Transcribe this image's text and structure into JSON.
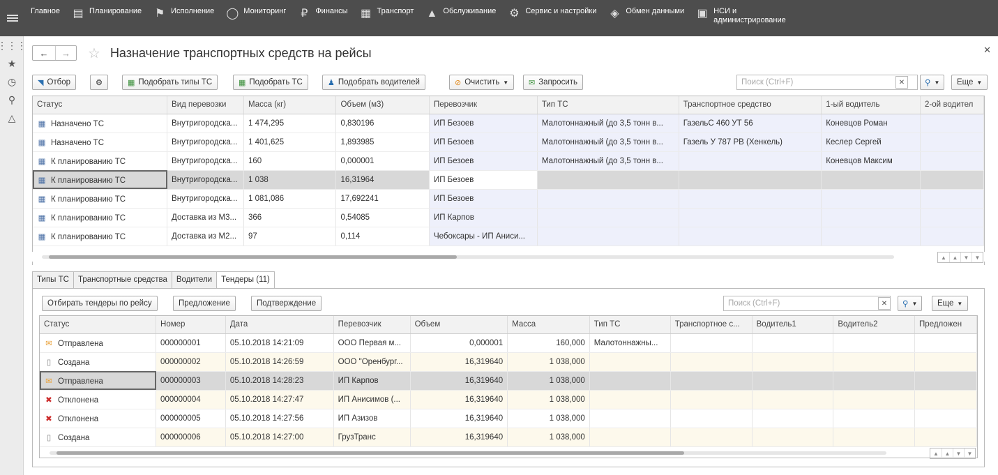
{
  "topmenu": [
    {
      "label": "Главное",
      "icon": "menu-icon"
    },
    {
      "label": "Планирование",
      "icon": "calendar-icon"
    },
    {
      "label": "Исполнение",
      "icon": "flag-icon"
    },
    {
      "label": "Мониторинг",
      "icon": "globe-icon"
    },
    {
      "label": "Финансы",
      "icon": "ruble-icon"
    },
    {
      "label": "Транспорт",
      "icon": "truck-icon"
    },
    {
      "label": "Обслуживание",
      "icon": "drop-icon"
    },
    {
      "label": "Сервис и настройки",
      "icon": "gear-icon"
    },
    {
      "label": "Обмен данными",
      "icon": "exchange-icon"
    },
    {
      "label": "НСИ и администрирование",
      "icon": "monitor-icon"
    }
  ],
  "page_title": "Назначение транспортных средств на рейсы",
  "toolbar": {
    "filter": "Отбор",
    "pick_types": "Подобрать типы ТС",
    "pick_vehicles": "Подобрать ТС",
    "pick_drivers": "Подобрать водителей",
    "clear": "Очистить",
    "request": "Запросить",
    "search_placeholder": "Поиск (Ctrl+F)",
    "more": "Еще"
  },
  "top_table": {
    "columns": [
      "Статус",
      "Вид перевозки",
      "Масса (кг)",
      "Объем (м3)",
      "Перевозчик",
      "Тип ТС",
      "Транспортное средство",
      "1-ый водитель",
      "2-ой водител"
    ],
    "rows": [
      [
        "Назначено ТС",
        "Внутригородска...",
        "1 474,295",
        "0,830196",
        "ИП Безоев",
        "Малотоннажный (до 3,5 тонн в...",
        "ГазельС 460 УТ 56",
        "Коневцов Роман",
        ""
      ],
      [
        "Назначено ТС",
        "Внутригородска...",
        "1 401,625",
        "1,893985",
        "ИП Безоев",
        "Малотоннажный (до 3,5 тонн в...",
        "Газель У 787 РВ (Хенкель)",
        "Кеслер Сергей",
        ""
      ],
      [
        "К планированию ТС",
        "Внутригородска...",
        "160",
        "0,000001",
        "ИП Безоев",
        "Малотоннажный (до 3,5 тонн в...",
        "",
        "Коневцов Максим",
        ""
      ],
      [
        "К планированию ТС",
        "Внутригородска...",
        "1 038",
        "16,31964",
        "ИП Безоев",
        "",
        "",
        "",
        ""
      ],
      [
        "К планированию ТС",
        "Внутригородска...",
        "1 081,086",
        "17,692241",
        "ИП Безоев",
        "",
        "",
        "",
        ""
      ],
      [
        "К планированию ТС",
        "Доставка из М3...",
        "366",
        "0,54085",
        "ИП Карпов",
        "",
        "",
        "",
        ""
      ],
      [
        "К планированию ТС",
        "Доставка из М2...",
        "97",
        "0,114",
        "Чебоксары - ИП Аниси...",
        "",
        "",
        "",
        ""
      ]
    ]
  },
  "tabs": [
    "Типы ТС",
    "Транспортные средства",
    "Водители",
    "Тендеры (11)"
  ],
  "tender_toolbar": {
    "filter_by_trip": "Отбирать тендеры по рейсу",
    "offer": "Предложение",
    "confirm": "Подтверждение",
    "search_placeholder": "Поиск (Ctrl+F)",
    "more": "Еще"
  },
  "tender_table": {
    "columns": [
      "Статус",
      "Номер",
      "Дата",
      "Перевозчик",
      "Объем",
      "Масса",
      "Тип ТС",
      "Транспортное с...",
      "Водитель1",
      "Водитель2",
      "Предложен"
    ],
    "rows": [
      [
        "Отправлена",
        "000000001",
        "05.10.2018 14:21:09",
        "ООО Первая м...",
        "0,000001",
        "160,000",
        "Малотоннажны...",
        "",
        "",
        "",
        ""
      ],
      [
        "Создана",
        "000000002",
        "05.10.2018 14:26:59",
        "ООО \"Оренбург...",
        "16,319640",
        "1 038,000",
        "",
        "",
        "",
        "",
        ""
      ],
      [
        "Отправлена",
        "000000003",
        "05.10.2018 14:28:23",
        "ИП Карпов",
        "16,319640",
        "1 038,000",
        "",
        "",
        "",
        "",
        ""
      ],
      [
        "Отклонена",
        "000000004",
        "05.10.2018 14:27:47",
        "ИП Анисимов (...",
        "16,319640",
        "1 038,000",
        "",
        "",
        "",
        "",
        ""
      ],
      [
        "Отклонена",
        "000000005",
        "05.10.2018 14:27:56",
        "ИП Азизов",
        "16,319640",
        "1 038,000",
        "",
        "",
        "",
        "",
        ""
      ],
      [
        "Создана",
        "000000006",
        "05.10.2018 14:27:00",
        "ГрузТранс",
        "16,319640",
        "1 038,000",
        "",
        "",
        "",
        "",
        ""
      ]
    ]
  },
  "colors": {
    "topbar": "#4d4d4d",
    "lavender_cell": "#eef0fb",
    "alt_row": "#fdf9ec",
    "selected_row": "#d8d8d8",
    "rejected_icon": "#cc2a2a",
    "sent_icon": "#e9a23b"
  }
}
